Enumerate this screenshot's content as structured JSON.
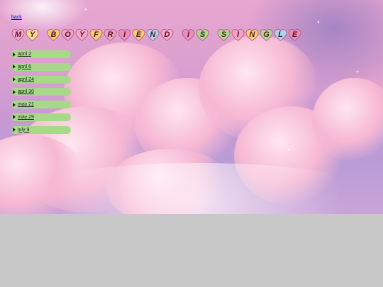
{
  "back_link": "back",
  "title": {
    "words": [
      {
        "letters": [
          {
            "ch": "M",
            "color": "#f7a8c8"
          },
          {
            "ch": "Y",
            "color": "#f6e08a"
          }
        ]
      },
      {
        "letters": [
          {
            "ch": "B",
            "color": "#f4cf6a"
          },
          {
            "ch": "O",
            "color": "#f4a3c4"
          },
          {
            "ch": "Y",
            "color": "#f7a8c8"
          },
          {
            "ch": "F",
            "color": "#f4cf6a"
          },
          {
            "ch": "R",
            "color": "#f0a2c0"
          },
          {
            "ch": "I",
            "color": "#e98fb7"
          },
          {
            "ch": "E",
            "color": "#f4cf6a"
          },
          {
            "ch": "N",
            "color": "#a9d5ee"
          },
          {
            "ch": "D",
            "color": "#f7a8c8"
          }
        ]
      },
      {
        "letters": [
          {
            "ch": "I",
            "color": "#e98fb7"
          },
          {
            "ch": "S",
            "color": "#a8dd88"
          }
        ]
      },
      {
        "letters": [
          {
            "ch": "S",
            "color": "#a8dd88"
          },
          {
            "ch": "I",
            "color": "#f4a3c4"
          },
          {
            "ch": "N",
            "color": "#f4cf6a"
          },
          {
            "ch": "G",
            "color": "#a8dd88"
          },
          {
            "ch": "L",
            "color": "#a9d5ee"
          },
          {
            "ch": "E",
            "color": "#e98fb7"
          }
        ]
      }
    ]
  },
  "nav": {
    "item_color": "#a8d98a",
    "items": [
      {
        "label": "april 2"
      },
      {
        "label": "april 6"
      },
      {
        "label": "april 24"
      },
      {
        "label": "april 30"
      },
      {
        "label": "may 21"
      },
      {
        "label": "may 29"
      },
      {
        "label": "july 9"
      }
    ]
  }
}
